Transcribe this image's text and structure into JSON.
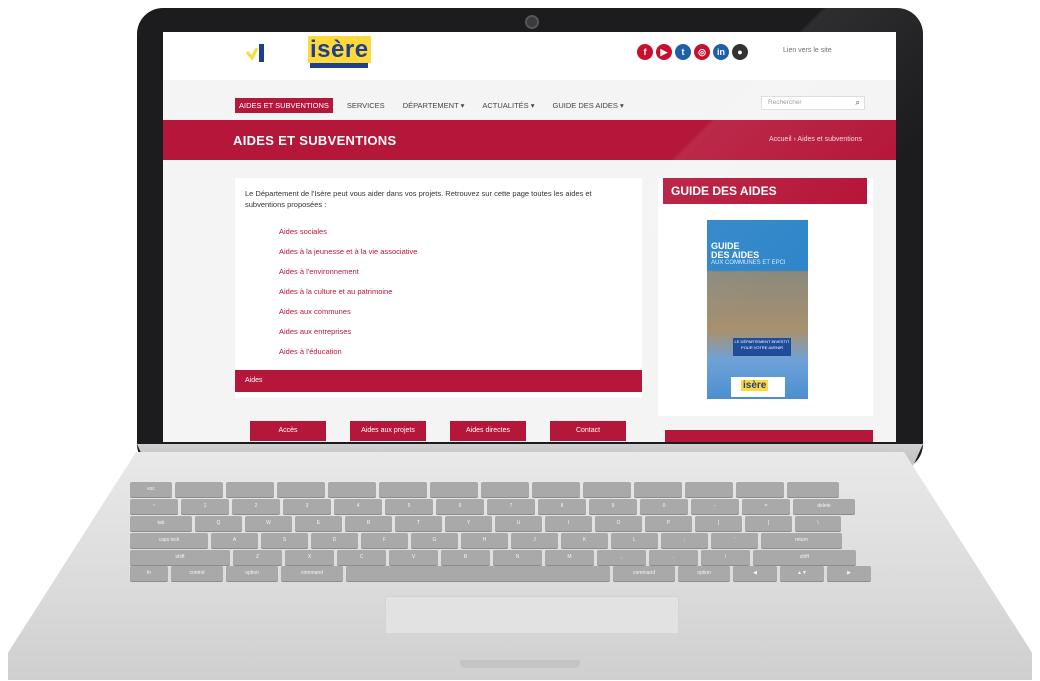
{
  "site": {
    "logo_text": "isère",
    "social_icons": [
      "facebook-icon",
      "youtube-icon",
      "twitter-icon",
      "instagram-icon",
      "linkedin-icon",
      "flickr-icon"
    ],
    "top_link": "Lien vers le site",
    "nav": [
      "AIDES ET SUBVENTIONS",
      "SERVICES",
      "DÉPARTEMENT ▾",
      "ACTUALITÉS ▾",
      "GUIDE DES AIDES ▾"
    ],
    "search_placeholder": "Rechercher",
    "banner_title": "AIDES ET SUBVENTIONS",
    "breadcrumb": "Accueil › Aides et subventions",
    "intro": "Le Département de l'Isère peut vous aider dans vos projets. Retrouvez sur cette page toutes les aides et subventions proposées :",
    "aid_items": [
      "Aides sociales",
      "Aides à la jeunesse et à la vie associative",
      "Aides à l'environnement",
      "Aides à la culture et au patrimoine",
      "Aides aux communes",
      "Aides aux entreprises",
      "Aides à l'éducation"
    ],
    "section_label": "Aides",
    "buttons": [
      "Accès",
      "Aides aux projets",
      "Aides directes",
      "Contact"
    ],
    "sidebar_title": "GUIDE DES AIDES",
    "cover_title_1": "GUIDE",
    "cover_title_2": "DES AIDES",
    "cover_subtitle": "AUX COMMUNES ET EPCI",
    "cover_band": "LE DÉPARTEMENT INVESTIT POUR VOTRE AVENIR",
    "cover_logo": "isère"
  },
  "keyboard": {
    "row1": [
      "esc",
      "",
      "",
      "",
      "",
      "",
      "",
      "",
      "",
      "",
      "",
      "",
      "",
      ""
    ],
    "row2": [
      "~",
      "1",
      "2",
      "3",
      "4",
      "5",
      "6",
      "7",
      "8",
      "9",
      "0",
      "-",
      "=",
      "delete"
    ],
    "row3": [
      "tab",
      "Q",
      "W",
      "E",
      "R",
      "T",
      "Y",
      "U",
      "I",
      "O",
      "P",
      "[",
      "]",
      "\\"
    ],
    "row4": [
      "caps lock",
      "A",
      "S",
      "D",
      "F",
      "G",
      "H",
      "J",
      "K",
      "L",
      ";",
      "'",
      "return"
    ],
    "row5": [
      "shift",
      "Z",
      "X",
      "C",
      "V",
      "B",
      "N",
      "M",
      ",",
      ".",
      "/",
      "shift"
    ],
    "row6": [
      "fn",
      "control",
      "option",
      "command",
      "",
      "command",
      "option",
      "◀",
      "▲▼",
      "▶"
    ]
  },
  "colors": {
    "brand_red": "#b5173a",
    "brand_blue": "#1f3f8c",
    "brand_yellow": "#ffd93a"
  }
}
